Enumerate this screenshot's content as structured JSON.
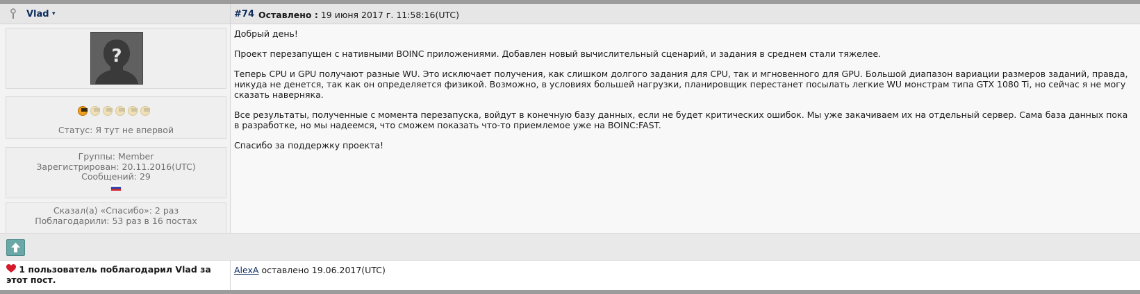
{
  "author": {
    "name": "Vlad",
    "caret": "▾",
    "status": "Статус: Я тут не впервой",
    "groups": "Группы: Member",
    "registered": "Зарегистрирован: 20.11.2016(UTC)",
    "messages": "Сообщений: 29",
    "said_thanks": "Сказал(а) «Спасибо»: 2 раз",
    "was_thanked": "Поблагодарили: 53 раз в 16 постах",
    "rank_level": 1,
    "rank_max": 6,
    "country_flag_colors": [
      "#ffffff",
      "#1c3fae",
      "#d3232c"
    ]
  },
  "post": {
    "number": "#74",
    "posted_label": "Оставлено :",
    "posted_date": "19 июня 2017 г. 11:58:16(UTC)",
    "paragraphs": [
      "Добрый день!",
      "Проект перезапущен с нативными BOINC приложениями. Добавлен новый вычислительный сценарий, и задания в среднем стали тяжелее.",
      "Теперь CPU и GPU получают разные WU. Это исключает получения, как слишком долгого задания для CPU, так и мгновенного для GPU. Большой диапазон вариации размеров заданий, правда, никуда не денется, так как он определяется физикой. Возможно, в условиях большей нагрузки, планировщик перестанет посылать легкие WU монстрам типа GTX 1080 Ti, но сейчас я не могу сказать наверняка.",
      "Все результаты, полученные с момента перезапуска, войдут в конечную базу данных, если не будет критических ошибок. Мы уже закачиваем их на отдельный сервер. Сама база данных пока в разработке, но мы надеемся, что сможем показать что-то приемлемое уже на BOINC:FAST.",
      "Спасибо за поддержку проекта!"
    ]
  },
  "thanks": {
    "summary": "1 пользователь поблагодарил Vlad за этот пост.",
    "user": "AlexA",
    "text": "оставлено 19.06.2017(UTC)"
  },
  "colors": {
    "username": "#0c2b5c",
    "header_bg": "#e6e6e6",
    "up_button": "#6aa8a8"
  }
}
